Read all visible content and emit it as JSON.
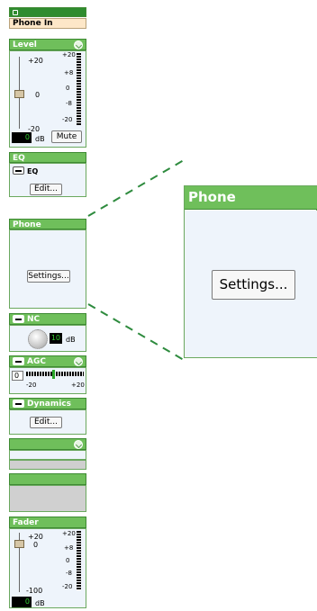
{
  "channel": {
    "title": "Phone In"
  },
  "level": {
    "header": "Level",
    "scale_left": [
      "+20",
      "0",
      "-20"
    ],
    "scale_right": [
      "+20",
      "+8",
      "0",
      "-8",
      "-20"
    ],
    "readout": "0",
    "unit": "dB",
    "mute_label": "Mute"
  },
  "eq": {
    "header": "EQ",
    "toggle_label": "EQ",
    "edit_label": "Edit..."
  },
  "phone": {
    "header": "Phone",
    "settings_label": "Settings..."
  },
  "nc": {
    "toggle_label": "NC",
    "readout": "10",
    "unit": "dB"
  },
  "agc": {
    "toggle_label": "AGC",
    "readout": "0",
    "scale": [
      "-20",
      "+20"
    ]
  },
  "dynamics": {
    "toggle_label": "Dynamics",
    "edit_label": "Edit..."
  },
  "fader": {
    "header": "Fader",
    "scale_left": [
      "+20",
      "0",
      "-100"
    ],
    "scale_right": [
      "+20",
      "+8",
      "0",
      "-8",
      "-20"
    ],
    "readout": "0",
    "unit": "dB"
  },
  "zoom": {
    "header": "Phone",
    "settings_label": "Settings..."
  },
  "colors": {
    "header_green": "#6fbf5b",
    "dark_green": "#2f8c2f",
    "panel_bg": "#eef4fb",
    "title_bg": "#fde7c8",
    "dash_green": "#2e8b3e"
  }
}
